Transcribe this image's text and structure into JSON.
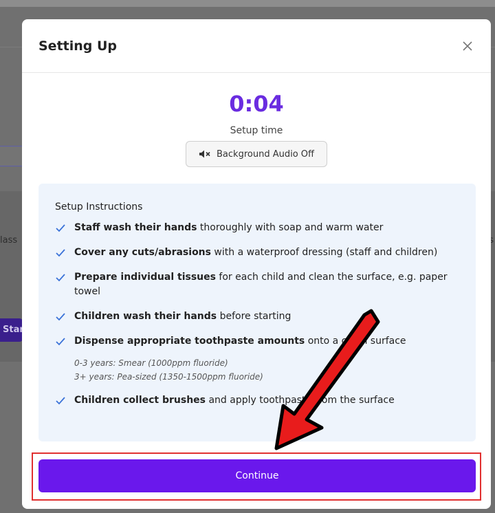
{
  "background": {
    "left_text": "lass",
    "right_text": "s",
    "start_button_label": "Star"
  },
  "modal": {
    "title": "Setting Up",
    "close_icon": "close-icon",
    "timer": "0:04",
    "timer_label": "Setup time",
    "audio_button": {
      "icon": "speaker-muted-icon",
      "label": "Background Audio Off"
    },
    "instructions": {
      "title": "Setup Instructions",
      "items": [
        {
          "bold": "Staff wash their hands",
          "rest": " thoroughly with soap and warm water"
        },
        {
          "bold": "Cover any cuts/abrasions",
          "rest": " with a waterproof dressing (staff and children)"
        },
        {
          "bold": "Prepare individual tissues",
          "rest": " for each child and clean the surface, e.g. paper towel"
        },
        {
          "bold": "Children wash their hands",
          "rest": " before starting"
        },
        {
          "bold": "Dispense appropriate toothpaste amounts",
          "rest": " onto a clean surface"
        },
        {
          "bold": "Children collect brushes",
          "rest": " and apply toothpaste from the surface"
        }
      ],
      "notes": [
        "0-3 years: Smear (1000ppm fluoride)",
        "3+ years: Pea-sized (1350-1500ppm fluoride)"
      ]
    },
    "continue_label": "Continue"
  },
  "colors": {
    "accent": "#6a18ec",
    "timer": "#6a2ce0",
    "annotation": "#e03030"
  }
}
